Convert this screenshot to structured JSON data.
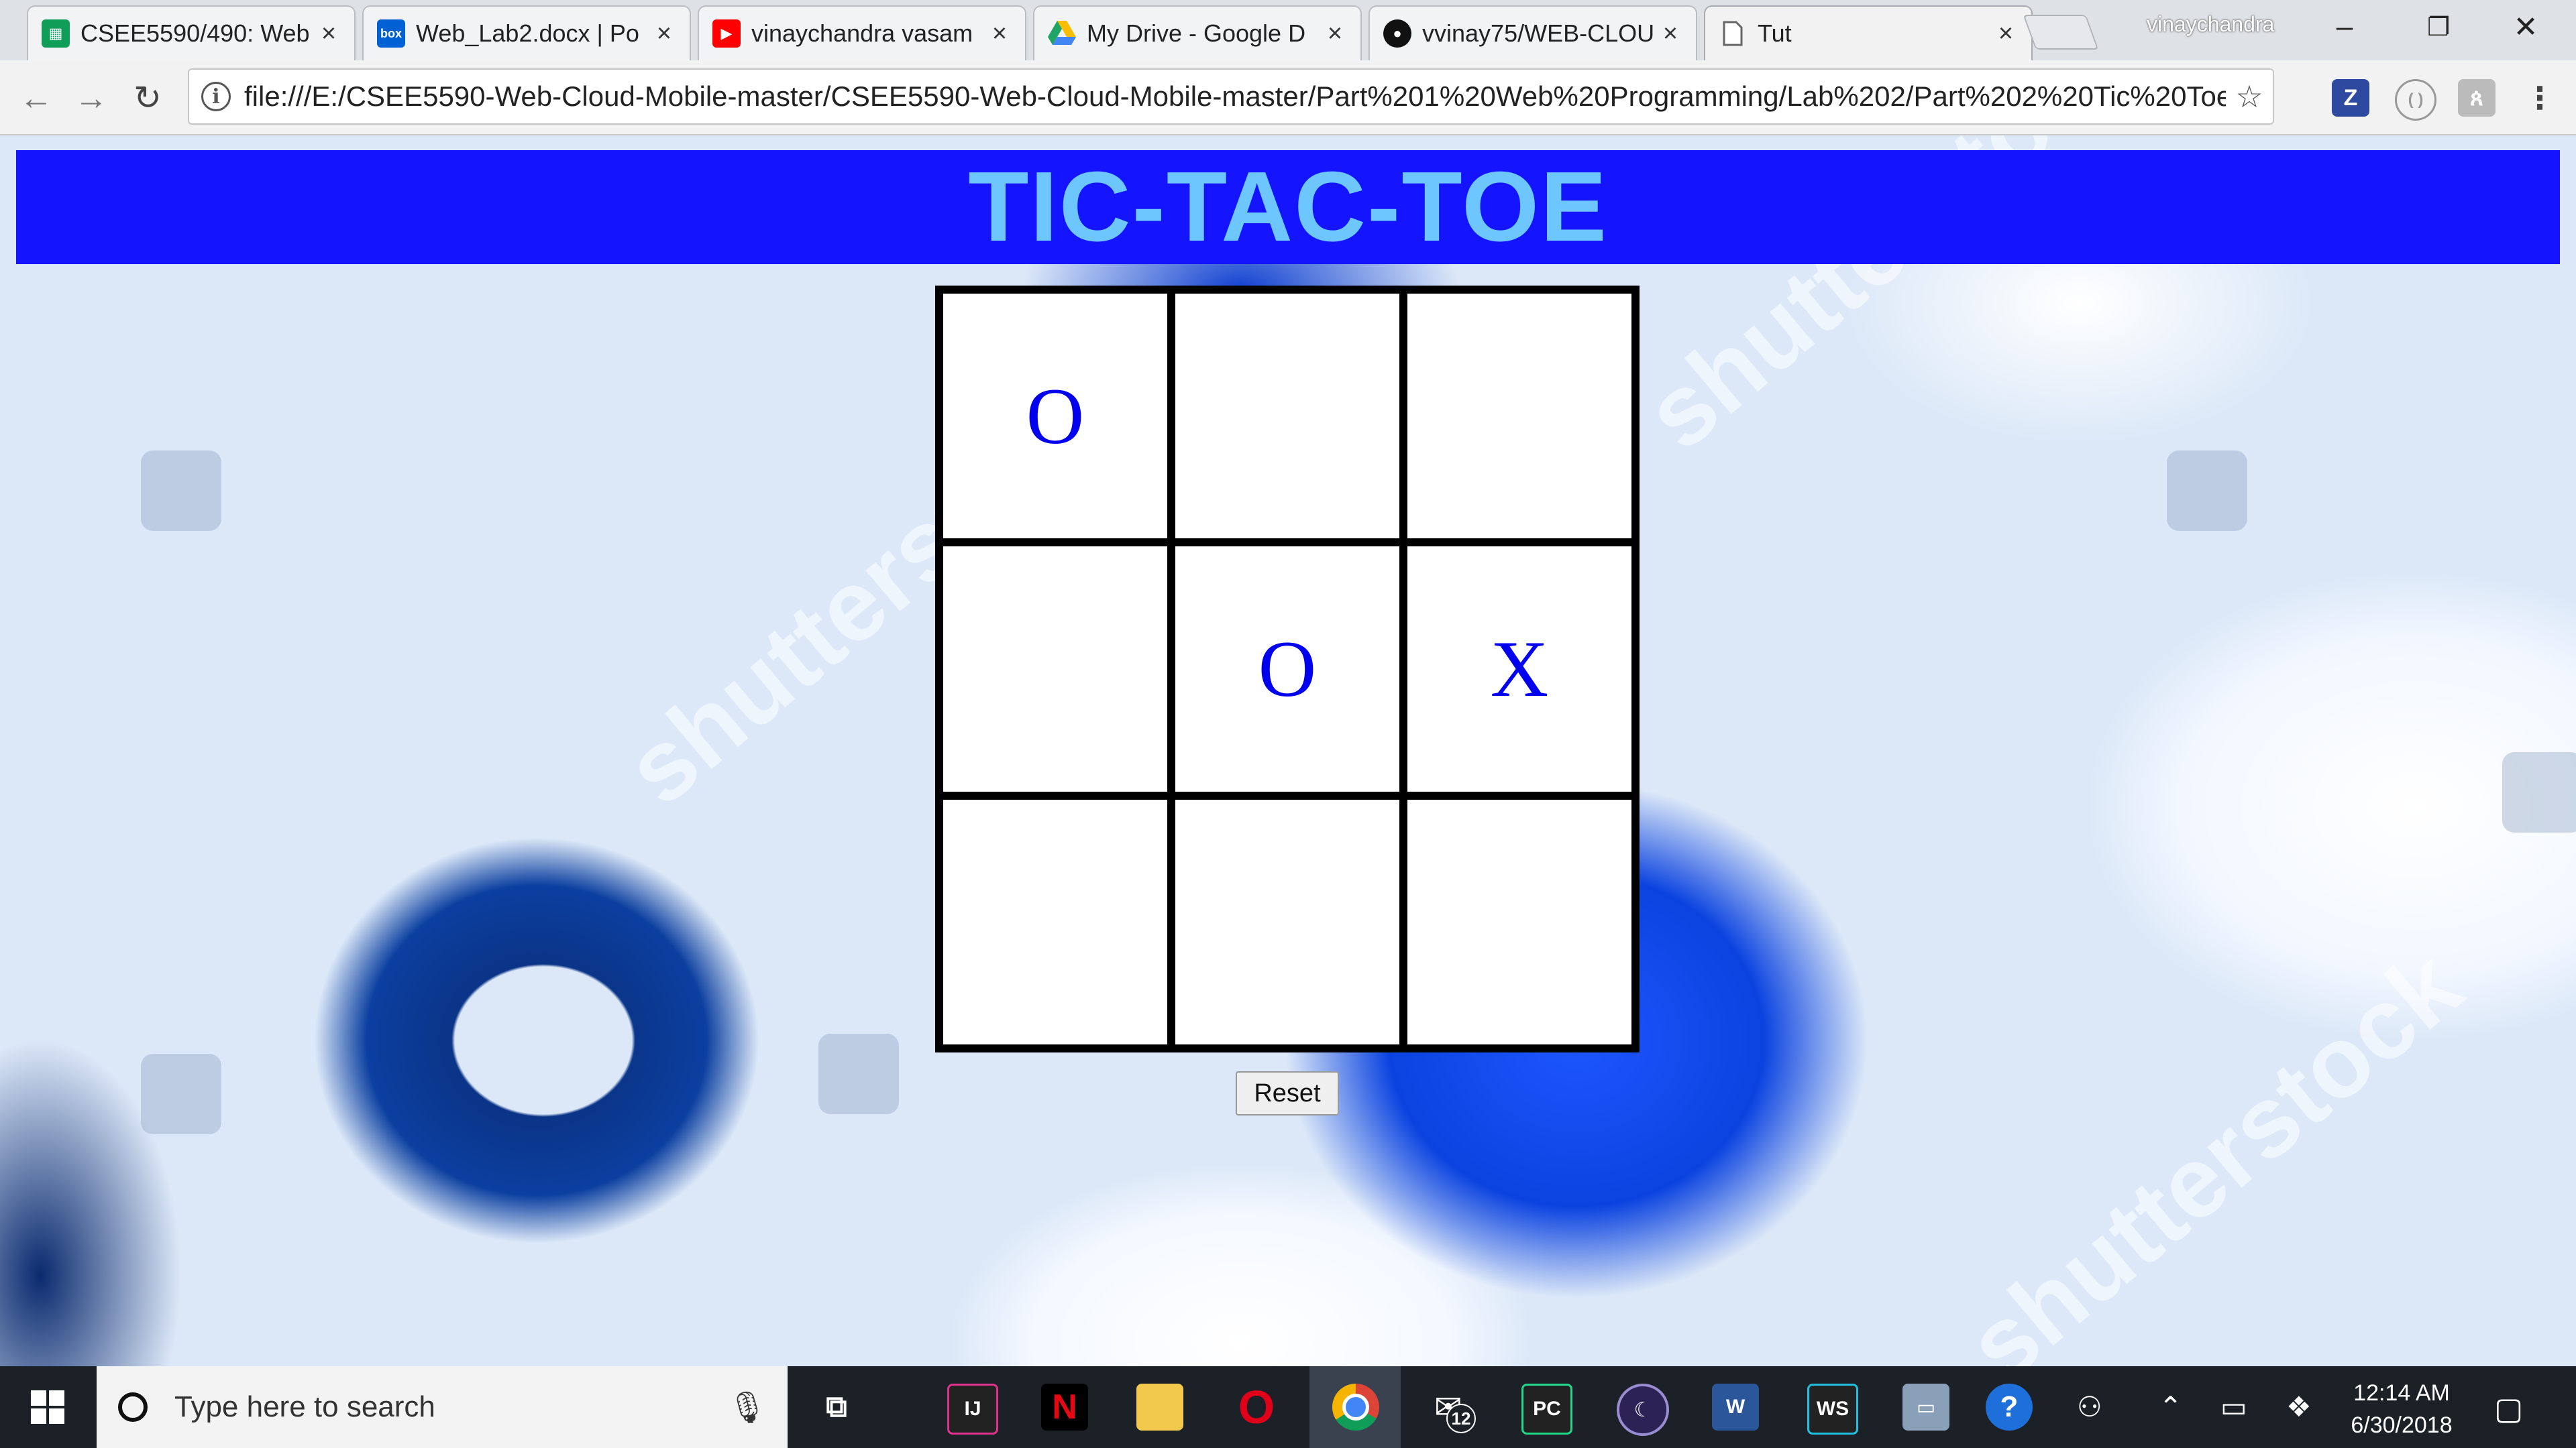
{
  "browser": {
    "tabs": [
      {
        "title": "CSEE5590/490: Web",
        "favicon": "sheets-icon",
        "color": "#0f9d58"
      },
      {
        "title": "Web_Lab2.docx | Po",
        "favicon": "box-icon",
        "color": "#0061d5"
      },
      {
        "title": "vinaychandra vasam",
        "favicon": "youtube-icon",
        "color": "#ff0000"
      },
      {
        "title": "My Drive - Google D",
        "favicon": "drive-icon",
        "color": "#1fa463"
      },
      {
        "title": "vvinay75/WEB-CLOU",
        "favicon": "github-icon",
        "color": "#111111"
      },
      {
        "title": "Tut",
        "favicon": "page-icon",
        "color": "#888888",
        "active": true
      }
    ],
    "profile_name": "vinaychandra",
    "url": "file:///E:/CSEE5590-Web-Cloud-Mobile-master/CSEE5590-Web-Cloud-Mobile-master/Part%201%20Web%20Programming/Lab%202/Part%202%20Tic%20Toe%2...",
    "extensions": [
      "zotero-icon",
      "extension-icon",
      "evernote-icon"
    ]
  },
  "page": {
    "title": "TIC-TAC-TOE",
    "board": [
      "O",
      "",
      "",
      "",
      "O",
      "X",
      "",
      "",
      ""
    ],
    "reset_label": "Reset",
    "colors": {
      "banner": "#1414ff",
      "title": "#6ec6ff",
      "marks": "#0000ee"
    },
    "watermark": "shutterstock"
  },
  "taskbar": {
    "search_placeholder": "Type here to search",
    "apps": [
      "task-view-icon",
      "intellij-icon",
      "netflix-icon",
      "file-explorer-icon",
      "opera-icon",
      "chrome-icon",
      "mail-icon",
      "pycharm-icon",
      "eclipse-icon",
      "word-icon",
      "webstorm-icon",
      "computer-icon",
      "help-icon"
    ],
    "mail_badge": "12",
    "time": "12:14 AM",
    "date": "6/30/2018"
  }
}
